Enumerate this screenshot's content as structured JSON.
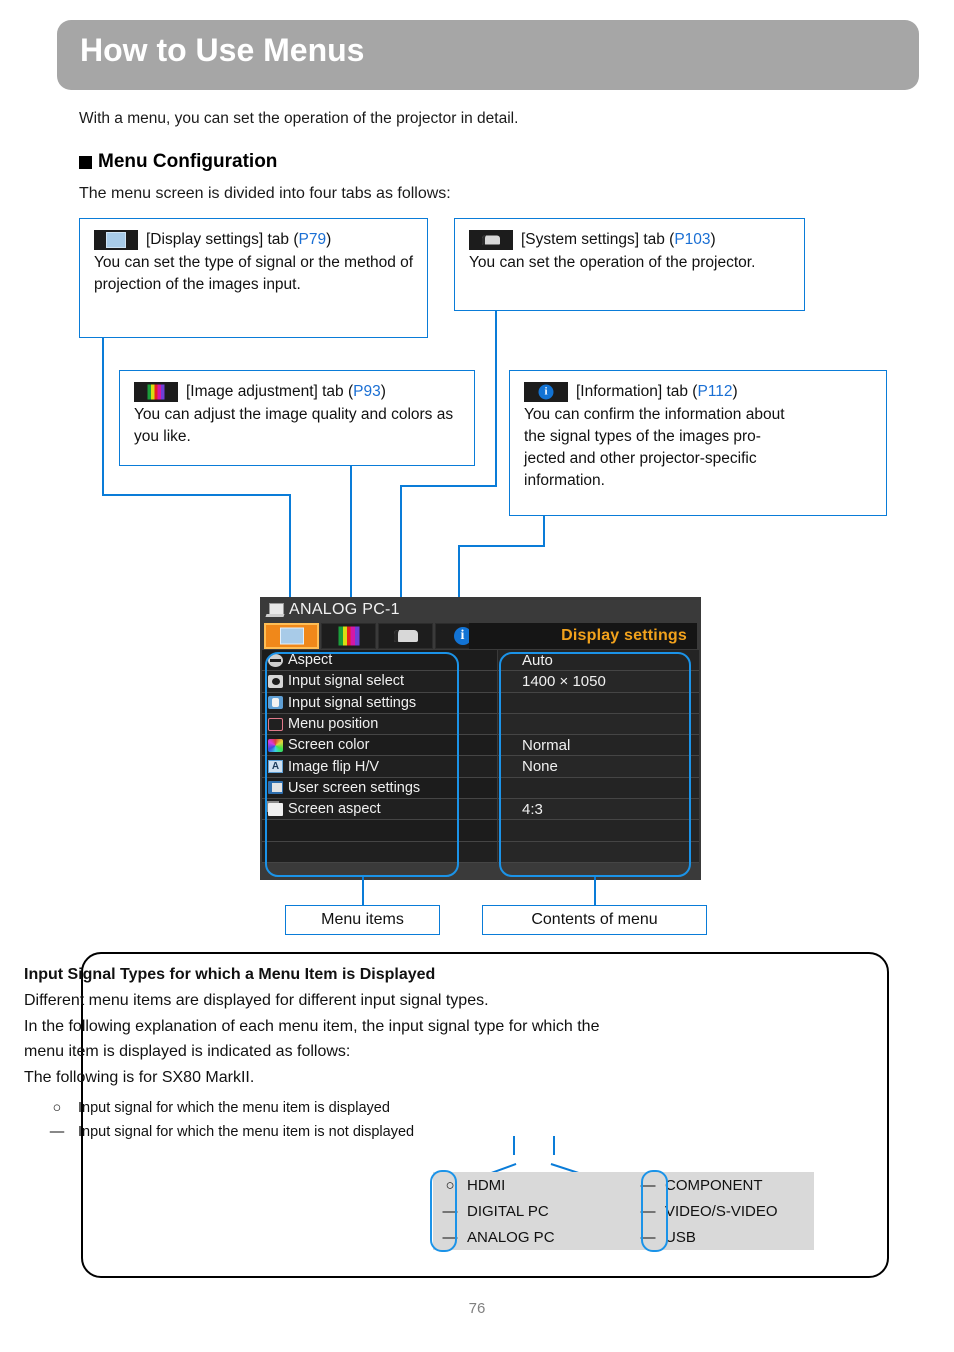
{
  "header": {
    "title": "How to Use Menus"
  },
  "intro": "With a menu, you can set the operation of the projector in detail.",
  "section": {
    "heading": "Menu Configuration",
    "subtitle": "The menu screen is divided into four tabs as follows:"
  },
  "callouts": {
    "display": {
      "icon": "display-settings-tab-icon",
      "label": "[Display settings] tab (",
      "page_ref": "P79",
      "label_close": ")",
      "body": "You can set the type of signal or the method of projection of the images input."
    },
    "system": {
      "icon": "system-settings-tab-icon",
      "label": "[System settings] tab (",
      "page_ref": "P103",
      "label_close": ")",
      "body": "You can set the operation of the projector."
    },
    "image": {
      "icon": "image-adjustment-tab-icon",
      "label": "[Image adjustment] tab (",
      "page_ref": "P93",
      "label_close": ")",
      "body": "You can adjust the image quality and colors as you like."
    },
    "information": {
      "icon": "information-tab-icon",
      "label": "[Information] tab (",
      "page_ref": "P112",
      "label_close": ")",
      "body": "You can confirm the information about the signal types of the images pro-jected and other projector-specific information.",
      "body_lines": [
        "You can confirm the information about",
        "the signal types of the images pro-",
        "jected and other projector-specific",
        "information."
      ]
    }
  },
  "osd": {
    "source": "ANALOG PC-1",
    "source_icon": "laptop-source-icon",
    "page_title": "Display settings",
    "tabs": [
      {
        "name": "display-settings-tab",
        "icon": "display-settings-tab-icon",
        "selected": true
      },
      {
        "name": "image-adjustment-tab",
        "icon": "image-adjustment-tab-icon",
        "selected": false
      },
      {
        "name": "system-settings-tab",
        "icon": "system-settings-tab-icon",
        "selected": false
      },
      {
        "name": "information-tab",
        "icon": "information-tab-icon",
        "selected": false
      }
    ],
    "menu_items": [
      {
        "icon": "aspect-icon",
        "label": "Aspect"
      },
      {
        "icon": "input-signal-select-icon",
        "label": "Input signal select"
      },
      {
        "icon": "input-signal-settings-icon",
        "label": "Input signal settings"
      },
      {
        "icon": "menu-position-icon",
        "label": "Menu position"
      },
      {
        "icon": "screen-color-icon",
        "label": "Screen color"
      },
      {
        "icon": "image-flip-icon",
        "label": "Image flip H/V"
      },
      {
        "icon": "user-screen-settings-icon",
        "label": "User screen settings"
      },
      {
        "icon": "screen-aspect-icon",
        "label": "Screen aspect"
      },
      {
        "icon": "",
        "label": ""
      },
      {
        "icon": "",
        "label": ""
      }
    ],
    "menu_values": [
      "Auto",
      "1400 × 1050",
      "",
      "",
      "Normal",
      "None",
      "",
      "4:3",
      "",
      ""
    ]
  },
  "labels": {
    "menu_items": "Menu items",
    "contents_of_menu": "Contents of menu"
  },
  "note": {
    "title": "Input Signal Types for which a Menu Item is Displayed",
    "lines": [
      "Different menu items are displayed for different input signal types.",
      "In the following explanation of each menu item, the input signal type for which the",
      "menu item is displayed is indicated as follows:",
      "The following is for SX80 MarkII."
    ],
    "bullets": [
      {
        "mark": "○",
        "text": "Input signal for which the menu item is displayed"
      },
      {
        "mark": "—",
        "text": "Input signal for which the menu item is not displayed"
      }
    ]
  },
  "signal_table": {
    "column_a": [
      {
        "mark": "○",
        "name": "HDMI"
      },
      {
        "mark": "—",
        "name": "DIGITAL PC"
      },
      {
        "mark": "—",
        "name": "ANALOG PC"
      }
    ],
    "column_b": [
      {
        "mark": "—",
        "name": "COMPONENT"
      },
      {
        "mark": "—",
        "name": "VIDEO/S-VIDEO"
      },
      {
        "mark": "—",
        "name": "USB"
      }
    ]
  },
  "page_number": "76",
  "colors": {
    "header_bar": "#a6a6a6",
    "connector_blue": "#0a7cd8",
    "page_ref_blue": "#1a6fd4",
    "osd_accent_orange": "#f2a21c",
    "osd_selected_tab": "#f0881a",
    "table_bg": "#d9d9d9"
  }
}
